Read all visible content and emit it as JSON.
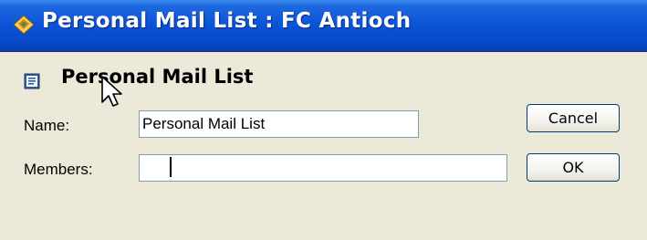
{
  "window": {
    "title": "Personal Mail List : FC Antioch",
    "icon": "notes-icon"
  },
  "form": {
    "heading": "Personal Mail List",
    "heading_icon": "form-icon",
    "name_label": "Name:",
    "name_value": "Personal Mail List",
    "members_label": "Members:",
    "members_value": ""
  },
  "buttons": {
    "cancel_label": "Cancel",
    "ok_label": "OK"
  },
  "colors": {
    "titlebar": "#0a52d6",
    "window_bg": "#ece9d8",
    "button_border": "#003c74"
  }
}
